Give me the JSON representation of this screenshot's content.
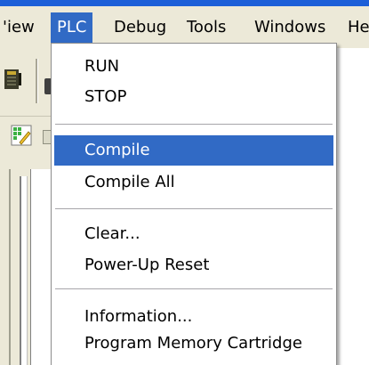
{
  "menubar": {
    "items": [
      {
        "label": "View"
      },
      {
        "label": "PLC"
      },
      {
        "label": "Debug"
      },
      {
        "label": "Tools"
      },
      {
        "label": "Windows"
      },
      {
        "label": "Help"
      }
    ],
    "visible_labels": [
      "'iew",
      "PLC",
      "Debug",
      "Tools",
      "Windows",
      "He"
    ],
    "active": "PLC"
  },
  "plc_menu": {
    "items": [
      {
        "label": "RUN"
      },
      {
        "label": "STOP"
      },
      {
        "label": "Compile",
        "highlighted": true
      },
      {
        "label": "Compile All"
      },
      {
        "label": "Clear..."
      },
      {
        "label": "Power-Up Reset"
      },
      {
        "label": "Information..."
      },
      {
        "label": "Program Memory Cartridge"
      }
    ]
  },
  "colors": {
    "menu_highlight": "#316ac5",
    "menubar_bg": "#ece9d8",
    "title_bar": "#1c5fd8"
  },
  "icons": {
    "toolbar": [
      "ladder-icon",
      "grid-edit-icon"
    ]
  }
}
